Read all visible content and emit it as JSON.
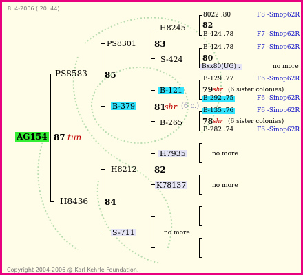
{
  "header": {
    "date": "8. 4-2006 ( 20: 44)"
  },
  "footer": {
    "copyright": "Copyright 2004-2006 @ Karl Kehrle Foundation."
  },
  "root": {
    "name": "AG154",
    "number": "87",
    "tag": "tun"
  },
  "gen1": {
    "sire": {
      "name": "PS8583",
      "number": "85"
    },
    "dam": {
      "name": "H8436",
      "number": "84"
    }
  },
  "gen2": {
    "ps8301": {
      "name": "PS8301",
      "number": "83"
    },
    "b379": {
      "name": "B-379",
      "number": "81",
      "tag": "shr",
      "note": "(6 c.)"
    },
    "h8212": {
      "name": "H8212",
      "number": "82"
    },
    "s711": {
      "name": "S-711",
      "note": "no more"
    }
  },
  "gen3": {
    "h8245": {
      "name": "H8245"
    },
    "s424": {
      "name": "S-424"
    },
    "b121": {
      "name": "B-121"
    },
    "b265": {
      "name": "B-265"
    },
    "h7935": {
      "name": "H7935",
      "note": "no more"
    },
    "k78137": {
      "name": "K78137",
      "note": "no more"
    }
  },
  "gen4": {
    "r1": {
      "name": "8022 .80",
      "origin": "F8 -Sinop62R"
    },
    "r2": {
      "number": "82"
    },
    "r3": {
      "name": "B-424 .78",
      "origin": "F7 -Sinop62R"
    },
    "r4": {
      "name": "B-424 .78",
      "origin": "F7 -Sinop62R"
    },
    "r5": {
      "number": "80"
    },
    "r6": {
      "name": "Bxx80(UG) .",
      "origin": "no more"
    },
    "r7": {
      "name": "B-129 .77",
      "origin": "F6 -Sinop62R"
    },
    "r8": {
      "number": "79",
      "tag": "shr",
      "note": "(6 sister colonies)"
    },
    "r9": {
      "name": "B-292 .75",
      "origin": "F6 -Sinop62R"
    },
    "r10": {
      "name": "B-135 .76",
      "origin": "F6 -Sinop62R"
    },
    "r11": {
      "number": "78",
      "tag": "shr",
      "note": "(6 sister colonies)"
    },
    "r12": {
      "name": "B-282 .74",
      "origin": "F6 -Sinop62R"
    }
  }
}
